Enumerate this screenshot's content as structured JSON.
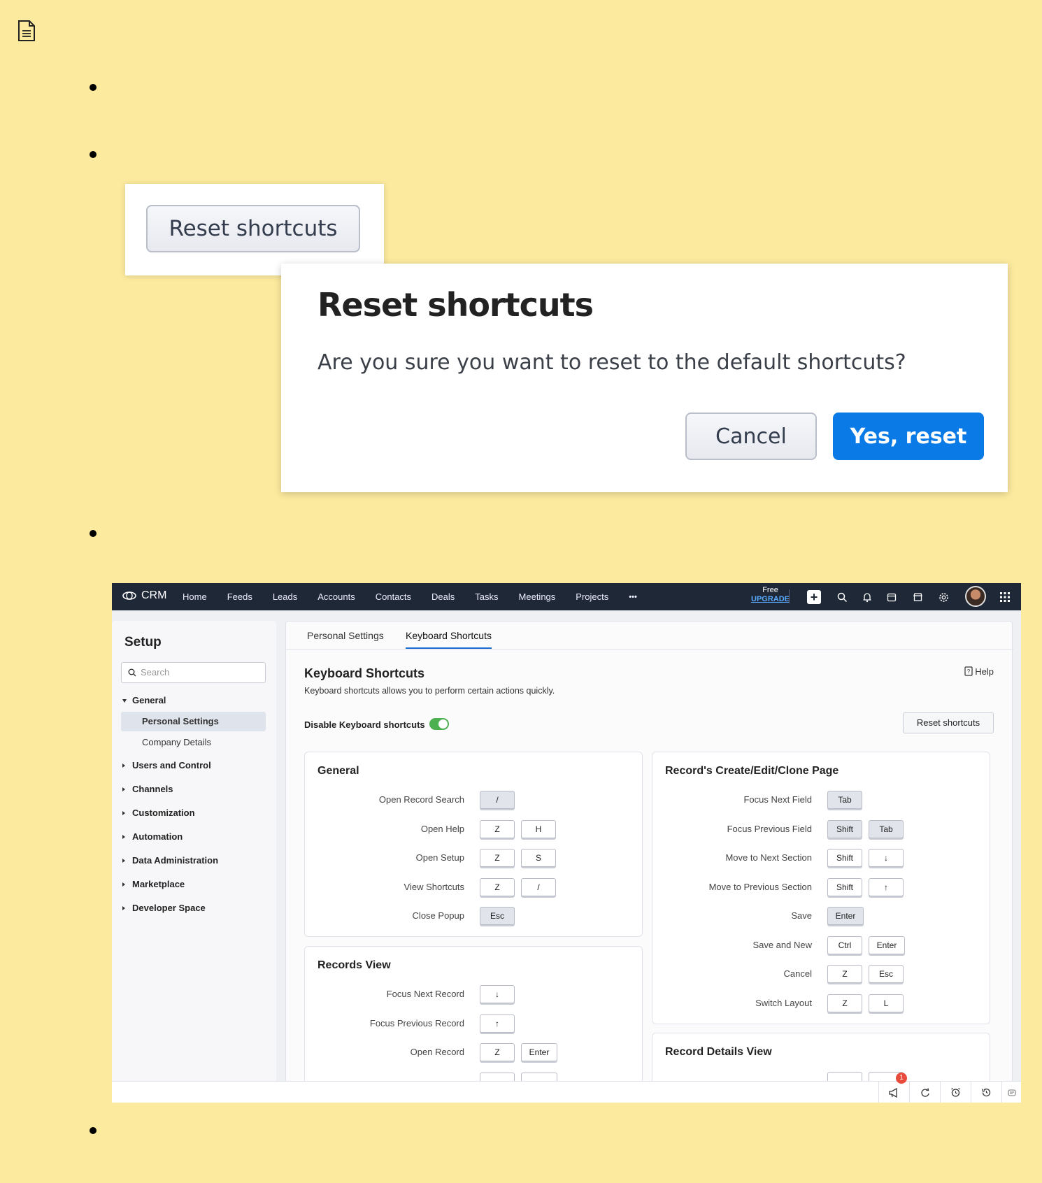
{
  "reset_panel": {
    "button_label": "Reset shortcuts"
  },
  "dialog": {
    "title": "Reset shortcuts",
    "message": "Are you sure you want to reset to the default shortcuts?",
    "cancel_label": "Cancel",
    "confirm_label": "Yes, reset",
    "confirm_color": "#0a7be6"
  },
  "crm": {
    "logo_text": "CRM",
    "nav": [
      "Home",
      "Feeds",
      "Leads",
      "Accounts",
      "Contacts",
      "Deals",
      "Tasks",
      "Meetings",
      "Projects"
    ],
    "more_label": "•••",
    "plan": {
      "free": "Free",
      "upgrade": "UPGRADE"
    },
    "icons": [
      "plus-icon",
      "search-icon",
      "bell-icon",
      "calendar-icon",
      "marketplace-icon",
      "gear-icon",
      "avatar",
      "apps-grid-icon"
    ],
    "sidebar": {
      "title": "Setup",
      "search_placeholder": "Search",
      "sections": {
        "general": "General",
        "personal_settings": "Personal Settings",
        "company_details": "Company Details",
        "users": "Users and Control",
        "channels": "Channels",
        "customization": "Customization",
        "automation": "Automation",
        "data_admin": "Data Administration",
        "marketplace": "Marketplace",
        "developer": "Developer Space"
      }
    },
    "tabs": {
      "personal": "Personal Settings",
      "keyboard": "Keyboard Shortcuts"
    },
    "page": {
      "title": "Keyboard Shortcuts",
      "description": "Keyboard shortcuts allows you to perform certain actions quickly.",
      "help": "Help",
      "disable_label": "Disable Keyboard shortcuts",
      "reset_label": "Reset shortcuts"
    },
    "general_card": {
      "title": "General",
      "rows": [
        {
          "label": "Open Record Search",
          "keys": [
            "/"
          ]
        },
        {
          "label": "Open Help",
          "keys": [
            "Z",
            "H"
          ]
        },
        {
          "label": "Open Setup",
          "keys": [
            "Z",
            "S"
          ]
        },
        {
          "label": "View Shortcuts",
          "keys": [
            "Z",
            "/"
          ]
        },
        {
          "label": "Close Popup",
          "keys": [
            "Esc"
          ]
        }
      ]
    },
    "records_card": {
      "title": "Records View",
      "rows": [
        {
          "label": "Focus Next Record",
          "keys": [
            "↓"
          ]
        },
        {
          "label": "Focus Previous Record",
          "keys": [
            "↑"
          ]
        },
        {
          "label": "Open Record",
          "keys": [
            "Z",
            "Enter"
          ]
        }
      ]
    },
    "create_card": {
      "title": "Record's Create/Edit/Clone Page",
      "rows": [
        {
          "label": "Focus Next Field",
          "keys": [
            "Tab"
          ]
        },
        {
          "label": "Focus Previous Field",
          "keys": [
            "Shift",
            "Tab"
          ]
        },
        {
          "label": "Move to Next Section",
          "keys": [
            "Shift",
            "↓"
          ]
        },
        {
          "label": "Move to Previous Section",
          "keys": [
            "Shift",
            "↑"
          ]
        },
        {
          "label": "Save",
          "keys": [
            "Enter"
          ]
        },
        {
          "label": "Save and New",
          "keys": [
            "Ctrl",
            "Enter"
          ]
        },
        {
          "label": "Cancel",
          "keys": [
            "Z",
            "Esc"
          ]
        },
        {
          "label": "Switch Layout",
          "keys": [
            "Z",
            "L"
          ]
        }
      ]
    },
    "details_card": {
      "title": "Record Details View"
    },
    "notification_count": "1"
  }
}
